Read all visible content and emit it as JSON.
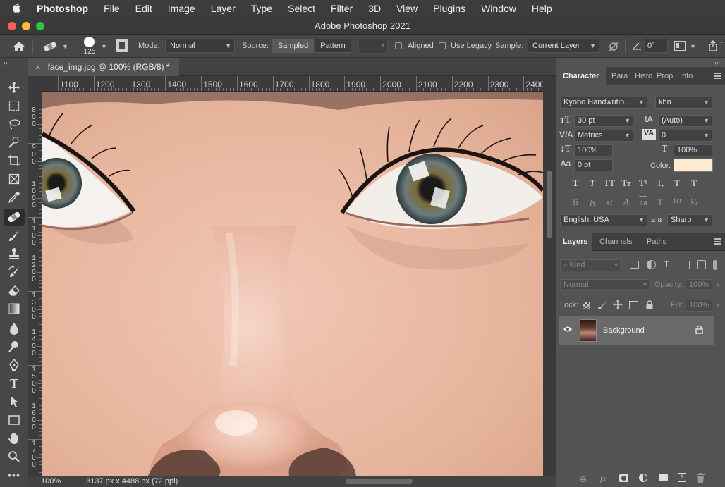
{
  "menubar": {
    "apple_icon": "apple-icon",
    "app_name": "Photoshop",
    "items": [
      "File",
      "Edit",
      "Image",
      "Layer",
      "Type",
      "Select",
      "Filter",
      "3D",
      "View",
      "Plugins",
      "Window",
      "Help"
    ]
  },
  "window": {
    "title": "Adobe Photoshop 2021",
    "traffic_lights": [
      "#fe5f57",
      "#febc2e",
      "#28c840"
    ]
  },
  "options_bar": {
    "brush_size": "125",
    "mode_label": "Mode:",
    "mode_value": "Normal",
    "source_label": "Source:",
    "sampled_label": "Sampled",
    "pattern_label": "Pattern",
    "aligned_label": "Aligned",
    "use_legacy_label": "Use Legacy",
    "sample_label": "Sample:",
    "sample_value": "Current Layer",
    "angle_value": "0°",
    "overflow_text": "f"
  },
  "document": {
    "tab_title": "face_img.jpg @ 100% (RGB/8) *",
    "zoom": "100%",
    "info": "3137 px x 4488 px (72 ppi)"
  },
  "ruler_h": [
    "1100",
    "1200",
    "1300",
    "1400",
    "1500",
    "1600",
    "1700",
    "1800",
    "1900",
    "2000",
    "2100",
    "2200",
    "2300",
    "2400"
  ],
  "ruler_v": [
    "800",
    "900",
    "1000",
    "1100",
    "1200",
    "1300",
    "1400",
    "1500",
    "1600",
    "1700"
  ],
  "character_panel": {
    "tabs": [
      "Character",
      "Para",
      "Histo",
      "Prop",
      "Info"
    ],
    "font_family": "Kyobo Handwritin...",
    "font_style": "khn",
    "font_size": "30 pt",
    "leading": "(Auto)",
    "kerning": "Metrics",
    "tracking": "0",
    "vertical_scale": "100%",
    "horizontal_scale": "100%",
    "baseline_shift": "0 pt",
    "color_label": "Color:",
    "color_swatch": "#fcebd2",
    "language": "English: USA",
    "aa_label": "a a",
    "antialias": "Sharp",
    "type_style_buttons": [
      "T",
      "T",
      "TT",
      "Tт",
      "T¹",
      "T,",
      "T",
      "Ŧ"
    ],
    "opentype_buttons": [
      "fi",
      "ꝺ",
      "st",
      "A",
      "aa",
      "T",
      "1st",
      "½"
    ]
  },
  "layers_panel": {
    "tabs": [
      "Layers",
      "Channels",
      "Paths"
    ],
    "filter_kind": "Kind",
    "blend_mode": "Normal",
    "opacity_label": "Opacity:",
    "opacity_value": "100%",
    "lock_label": "Lock:",
    "fill_label": "Fill:",
    "fill_value": "100%",
    "layers": [
      {
        "name": "Background",
        "visible": true,
        "locked": true
      }
    ]
  },
  "colors": {
    "menubar_bg": "#3c3c3c",
    "panel_bg": "#535353",
    "dark_bg": "#474747"
  }
}
